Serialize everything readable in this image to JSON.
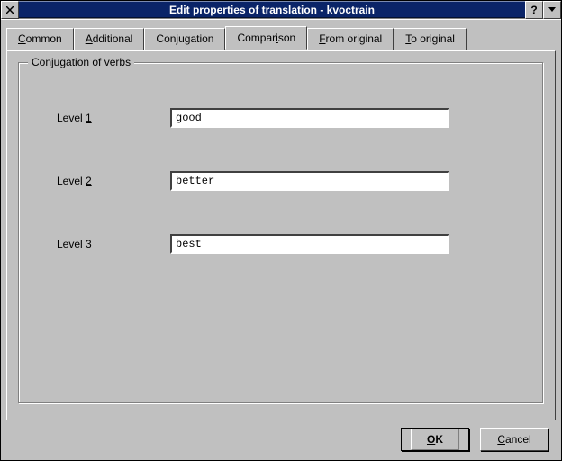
{
  "window": {
    "title": "Edit properties of translation - kvoctrain"
  },
  "tabs": [
    {
      "pre": "",
      "accel": "C",
      "post": "ommon"
    },
    {
      "pre": "",
      "accel": "A",
      "post": "dditional"
    },
    {
      "pre": "Con",
      "accel": "j",
      "post": "ugation"
    },
    {
      "pre": "Compar",
      "accel": "i",
      "post": "son"
    },
    {
      "pre": "",
      "accel": "F",
      "post": "rom original"
    },
    {
      "pre": "",
      "accel": "T",
      "post": "o original"
    }
  ],
  "active_tab_index": 3,
  "group": {
    "title": "Conjugation of verbs"
  },
  "fields": [
    {
      "label_pre": "Level ",
      "label_accel": "1",
      "label_post": "",
      "value": "good"
    },
    {
      "label_pre": "Level ",
      "label_accel": "2",
      "label_post": "",
      "value": "better"
    },
    {
      "label_pre": "Level ",
      "label_accel": "3",
      "label_post": "",
      "value": "best"
    }
  ],
  "buttons": {
    "ok_pre": "",
    "ok_accel": "O",
    "ok_post": "K",
    "cancel_pre": "",
    "cancel_accel": "C",
    "cancel_post": "ancel"
  }
}
